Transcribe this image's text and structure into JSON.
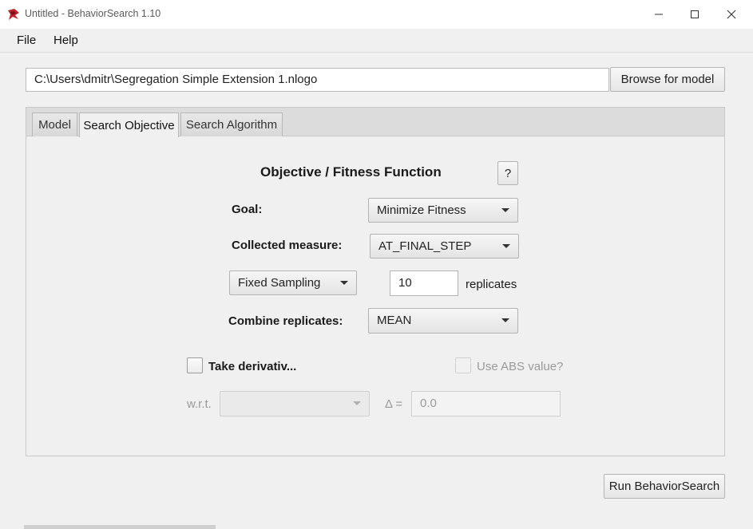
{
  "window": {
    "title": "Untitled - BehaviorSearch 1.10",
    "controls": {
      "minimize": "—",
      "maximize": "☐",
      "close": "✕"
    }
  },
  "menu": {
    "items": [
      "File",
      "Help"
    ]
  },
  "model": {
    "path": "C:\\Users\\dmitr\\Segregation Simple Extension 1.nlogo",
    "browse_label": "Browse for model"
  },
  "tabs": [
    {
      "label": "Model",
      "active": false
    },
    {
      "label": "Search Objective",
      "active": true
    },
    {
      "label": "Search Algorithm",
      "active": false
    }
  ],
  "objective": {
    "heading": "Objective / Fitness Function",
    "help_label": "?",
    "goal_label": "Goal:",
    "goal_value": "Minimize Fitness",
    "measure_label": "Collected measure:",
    "measure_value": "AT_FINAL_STEP",
    "sampling_value": "Fixed Sampling",
    "replicates_value": "10",
    "replicates_label": "replicates",
    "combine_label": "Combine replicates:",
    "combine_value": "MEAN",
    "derivative_label": "Take derivativ...",
    "derivative_checked": false,
    "abs_label": "Use ABS value?",
    "abs_checked": false,
    "wrt_label": "w.r.t.",
    "wrt_value": "",
    "delta_label": "Δ =",
    "delta_value": "0.0"
  },
  "run_label": "Run BehaviorSearch",
  "colors": {
    "window_bg": "#f0f0f0",
    "tab_header_bg": "#dcdcdc",
    "icon_red": "#c0242a"
  }
}
